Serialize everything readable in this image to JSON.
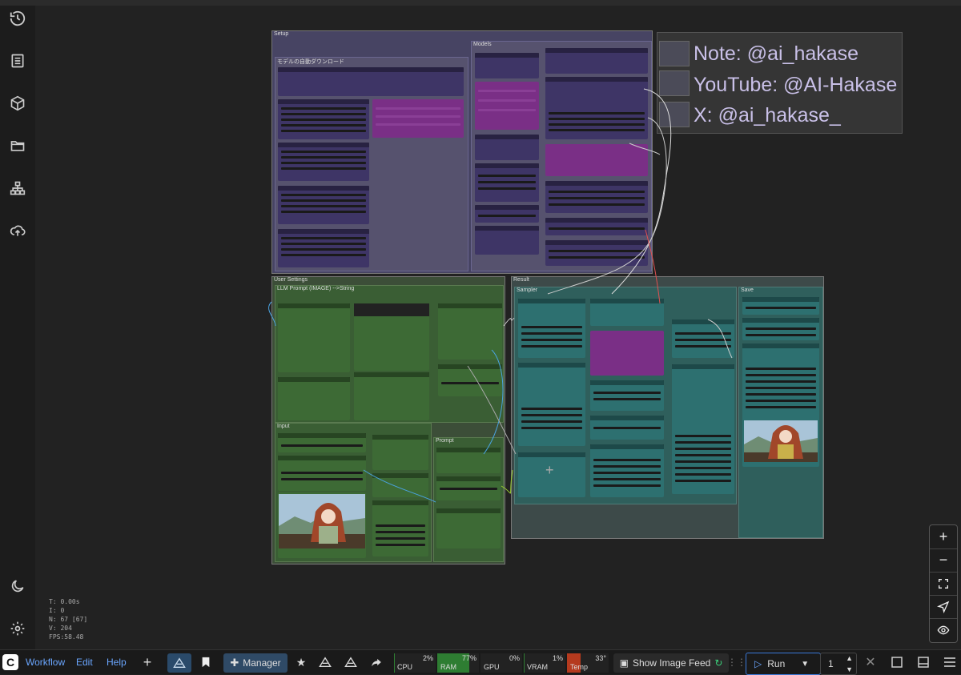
{
  "sidebar": {
    "items": [
      {
        "icon": "history-icon",
        "name": "Queue history"
      },
      {
        "icon": "document-icon",
        "name": "Workflows"
      },
      {
        "icon": "cube-icon",
        "name": "Models"
      },
      {
        "icon": "folder-icon",
        "name": "Files"
      },
      {
        "icon": "node-library-icon",
        "name": "Node library"
      },
      {
        "icon": "cloud-upload-icon",
        "name": "Upload"
      }
    ],
    "bottom": [
      {
        "icon": "moon-icon"
      },
      {
        "icon": "gear-icon"
      }
    ]
  },
  "canvas": {
    "groups": {
      "setup": "Setup",
      "auto_download": "モデルの自動ダウンロード",
      "models": "Models",
      "user_settings": "User Settings",
      "llm_prompt": "LLM Prompt (IMAGE) -->String",
      "input": "Input",
      "prompt": "Prompt",
      "result": "Result",
      "sampler": "Sampler",
      "save": "Save"
    },
    "note": {
      "lines": [
        "Note: @ai_hakase",
        "YouTube: @AI-Hakase",
        "X: @ai_hakase_"
      ]
    },
    "stats": {
      "t": "T: 0.00s",
      "i": "I: 0",
      "n": "N: 67 [67]",
      "v": "V: 204",
      "fps": "FPS:58.48"
    }
  },
  "zoom_controls": {
    "zoom_in": "+",
    "zoom_out": "−",
    "fit": "fit-view-icon",
    "locate": "navigate-icon",
    "eye": "eye-icon"
  },
  "bottombar": {
    "menu": [
      "Workflow",
      "Edit",
      "Help"
    ],
    "manager_label": "Manager",
    "monitors": [
      {
        "label": "CPU",
        "value": "2%",
        "fill": 0.02,
        "color": "#2e7d32"
      },
      {
        "label": "RAM",
        "value": "77%",
        "fill": 0.77,
        "color": "#2e7d32"
      },
      {
        "label": "GPU",
        "value": "0%",
        "fill": 0.0,
        "color": "#2e7d32"
      },
      {
        "label": "VRAM",
        "value": "1%",
        "fill": 0.01,
        "color": "#2e7d32"
      },
      {
        "label": "Temp",
        "value": "33°",
        "fill": 0.33,
        "color": "#b53a1e"
      }
    ],
    "show_image_feed": "Show Image Feed",
    "run_label": "Run",
    "batch_count": "1"
  },
  "colors": {
    "accent": "#3a78d8",
    "purple_node": "#3e3566",
    "magenta_node": "#7a2f86",
    "green_group": "#3a5e34",
    "teal_group": "#2f5f5c"
  }
}
